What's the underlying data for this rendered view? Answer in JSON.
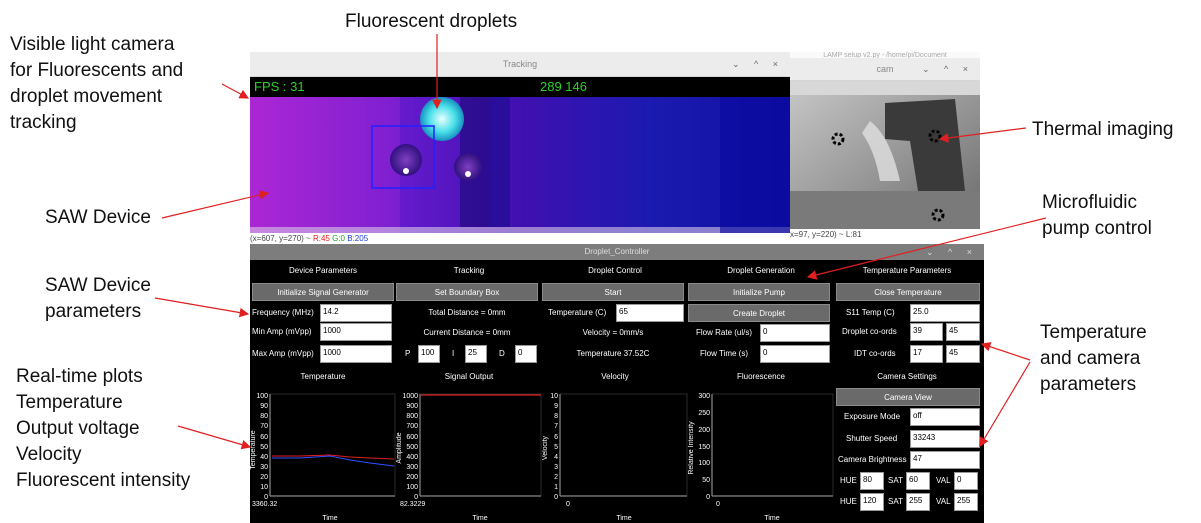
{
  "annotations": {
    "visible_camera": [
      "Visible light camera",
      "for Fluorescents and",
      "droplet movement",
      "tracking"
    ],
    "fluorescent_droplets": "Fluorescent droplets",
    "thermal_imaging": "Thermal imaging",
    "saw_device": "SAW Device",
    "microfluidic": [
      "Microfluidic",
      "pump control"
    ],
    "saw_params": [
      "SAW Device",
      "parameters"
    ],
    "realtime": [
      "Real-time plots",
      "Temperature",
      "Output voltage",
      "Velocity",
      "Fluorescent intensity"
    ],
    "temp_camera": [
      "Temperature",
      "and camera",
      "parameters"
    ]
  },
  "tracking_window": {
    "title": "Tracking",
    "fps": "FPS : 31",
    "coords": "289 146",
    "status_prefix": "(x=607, y=270) ~",
    "status_r": "R:45",
    "status_g": "G:0",
    "status_b": "B:205",
    "controls": "⌄ ^ ×"
  },
  "cam_window": {
    "title": "cam",
    "behind_title": "LAMP setup v2.py - /home/pi/Document",
    "status": "x=97, y=220) ~ L:81",
    "controls": "⌄ ^ ×"
  },
  "controller": {
    "title": "Droplet_Controller",
    "controls": "⌄ ^ ×",
    "device": {
      "header": "Device Parameters",
      "init_button": "Initialize Signal Generator",
      "freq_label": "Frequency (MHz)",
      "freq_value": "14.2",
      "min_label": "Min Amp (mVpp)",
      "min_value": "1000",
      "max_label": "Max Amp (mVpp)",
      "max_value": "1000"
    },
    "tracking": {
      "header": "Tracking",
      "set_button": "Set Boundary Box",
      "total_distance": "Total Distance = 0mm",
      "current_distance": "Current Distance = 0mm",
      "p_label": "P",
      "p_value": "100",
      "i_label": "I",
      "i_value": "25",
      "d_label": "D",
      "d_value": "0"
    },
    "droplet_control": {
      "header": "Droplet Control",
      "start_button": "Start",
      "temp_label": "Temperature (C)",
      "temp_value": "65",
      "velocity": "Velocity = 0mm/s",
      "temperature": "Temperature 37.52C"
    },
    "droplet_generation": {
      "header": "Droplet Generation",
      "init_pump_button": "Initialize Pump",
      "create_button": "Create Droplet",
      "flow_rate_label": "Flow Rate (ul/s)",
      "flow_rate_value": "0",
      "flow_time_label": "Flow Time (s)",
      "flow_time_value": "0"
    },
    "temperature_params": {
      "header": "Temperature Parameters",
      "close_button": "Close Temperature",
      "s11_label": "S11 Temp (C)",
      "s11_value": "25.0",
      "droplet_label": "Droplet co-ords",
      "droplet_x": "39",
      "droplet_y": "45",
      "idt_label": "IDT co-ords",
      "idt_x": "17",
      "idt_y": "45"
    },
    "camera_settings": {
      "header": "Camera Settings",
      "view_button": "Camera View",
      "exposure_label": "Exposure Mode",
      "exposure_value": "off",
      "shutter_label": "Shutter Speed",
      "shutter_value": "33243",
      "brightness_label": "Camera Brightness",
      "brightness_value": "47",
      "hue_label": "HUE",
      "sat_label": "SAT",
      "val_label": "VAL",
      "hue1": "80",
      "sat1": "60",
      "val1": "0",
      "hue2": "120",
      "sat2": "255",
      "val2": "255"
    },
    "plots": [
      {
        "title": "Temperature",
        "ylabel": "Temperature",
        "xlabel": "Time",
        "xtick": "3360.32",
        "yticks": [
          "100",
          "90",
          "80",
          "70",
          "60",
          "50",
          "40",
          "30",
          "20",
          "10",
          "0"
        ]
      },
      {
        "title": "Signal Output",
        "ylabel": "Amplitude",
        "xlabel": "Time",
        "xtick": "82.3229",
        "yticks": [
          "1000",
          "900",
          "800",
          "700",
          "600",
          "500",
          "400",
          "300",
          "200",
          "100",
          "0"
        ]
      },
      {
        "title": "Velocity",
        "ylabel": "Velocity",
        "xlabel": "Time",
        "xtick": "0",
        "yticks": [
          "10",
          "9",
          "8",
          "7",
          "6",
          "5",
          "4",
          "3",
          "2",
          "1",
          "0"
        ]
      },
      {
        "title": "Fluorescence",
        "ylabel": "Relative Intensity",
        "xlabel": "Time",
        "xtick": "0",
        "yticks": [
          "300",
          "250",
          "200",
          "150",
          "100",
          "50",
          "0"
        ]
      }
    ]
  },
  "colors": {
    "panel_bg": "#000000",
    "button_bg": "#6a6a6a",
    "arrow": "#e02020",
    "fps_text": "#2bd12b"
  }
}
